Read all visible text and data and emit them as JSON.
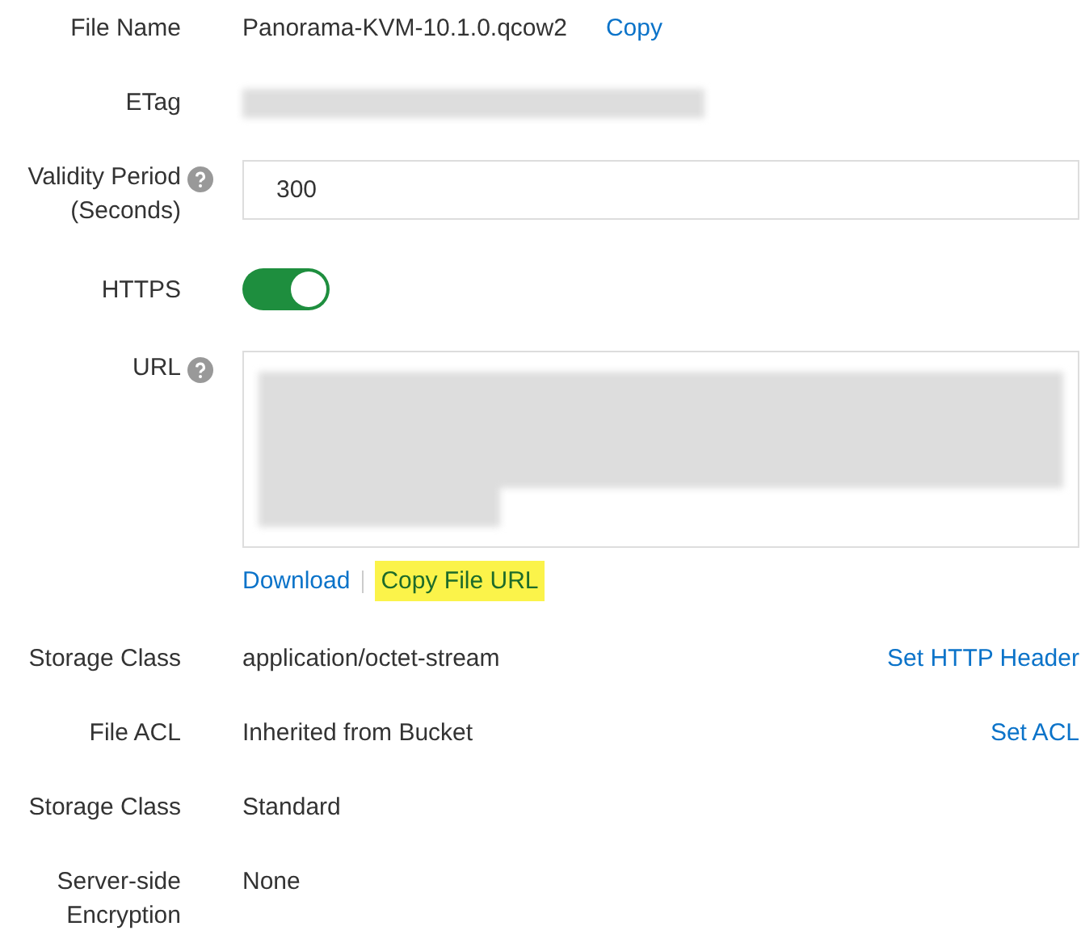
{
  "rows": [
    {
      "label": "File Name",
      "kind": "text",
      "value": "Panorama-KVM-10.1.0.qcow2",
      "link": "Copy"
    },
    {
      "label": "ETag",
      "kind": "redacted"
    },
    {
      "label": "Validity Period (Seconds)",
      "help": true,
      "kind": "input",
      "value": "300"
    },
    {
      "label": "HTTPS",
      "kind": "toggle",
      "on": true
    },
    {
      "label": "URL",
      "help": true,
      "kind": "url",
      "actions": [
        {
          "label": "Download",
          "highlighted": false
        },
        {
          "label": "Copy File URL",
          "highlighted": true
        }
      ]
    },
    {
      "label": "Storage Class",
      "kind": "text",
      "value": "application/octet-stream",
      "right_link": "Set HTTP Header"
    },
    {
      "label": "File ACL",
      "kind": "text",
      "value": "Inherited from Bucket",
      "right_link": "Set ACL"
    },
    {
      "label": "Storage Class",
      "kind": "text",
      "value": "Standard"
    },
    {
      "label": "Server-side Encryption",
      "kind": "text",
      "value": "None"
    }
  ]
}
